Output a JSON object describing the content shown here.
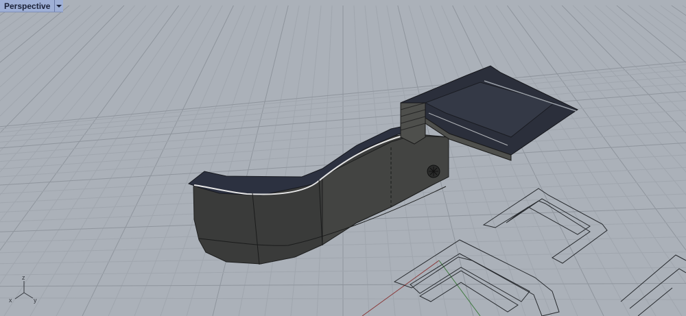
{
  "viewport": {
    "name": "Perspective",
    "menu_icon": "chevron-down-icon"
  },
  "axes": {
    "x_label": "x",
    "y_label": "y",
    "z_label": "z"
  },
  "colors": {
    "background": "#abb1b9",
    "grid_minor": "#a0a6ae",
    "grid_major": "#8f959d",
    "model_body": "#3a3b3a",
    "model_top": "#2a3040",
    "curve": "#25282c",
    "x_axis": "#8a3a3a",
    "y_axis": "#3f7a3f"
  }
}
